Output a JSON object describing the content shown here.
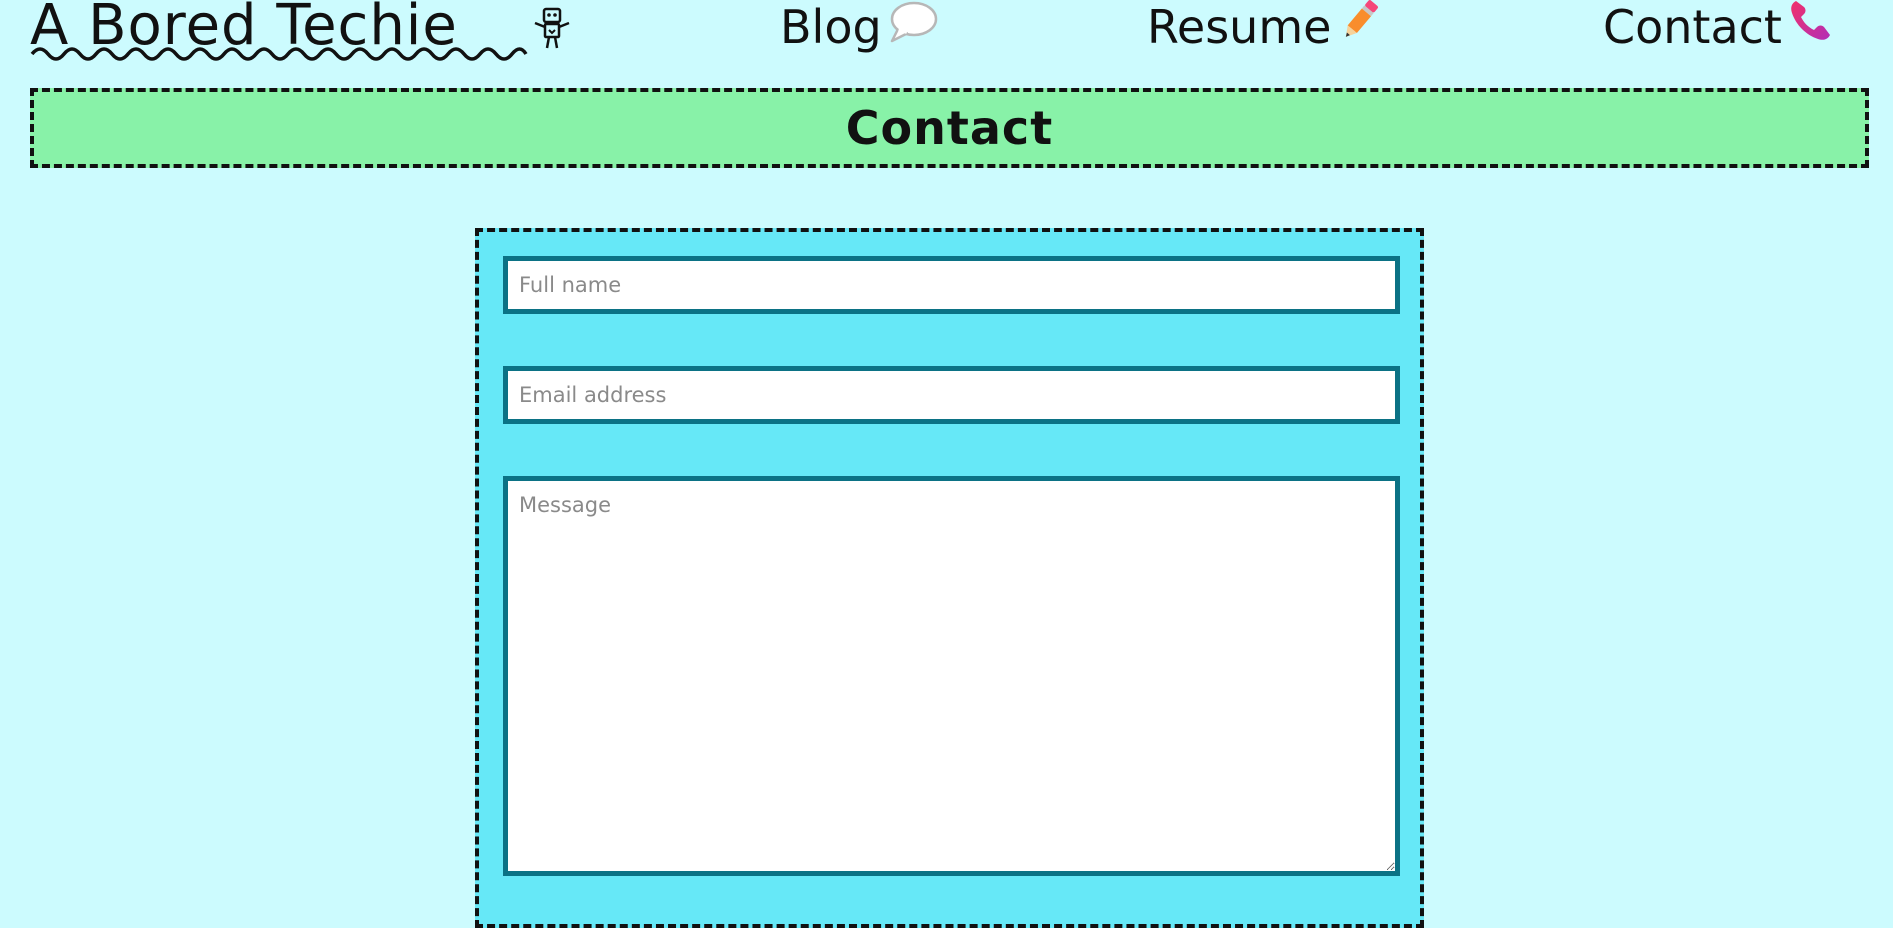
{
  "header": {
    "brand": "A Bored Techie",
    "nav": [
      {
        "label": "Blog",
        "icon": "speech-bubble-icon"
      },
      {
        "label": "Resume",
        "icon": "pencil-icon"
      },
      {
        "label": "Contact",
        "icon": "phone-icon"
      }
    ]
  },
  "page": {
    "title": "Contact"
  },
  "form": {
    "name_placeholder": "Full name",
    "email_placeholder": "Email address",
    "message_placeholder": "Message",
    "name_value": "",
    "email_value": "",
    "message_value": ""
  },
  "colors": {
    "background": "#ccfbfe",
    "title_banner": "#88f2a8",
    "form_panel": "#66e8f7",
    "field_border": "#0b7285"
  }
}
